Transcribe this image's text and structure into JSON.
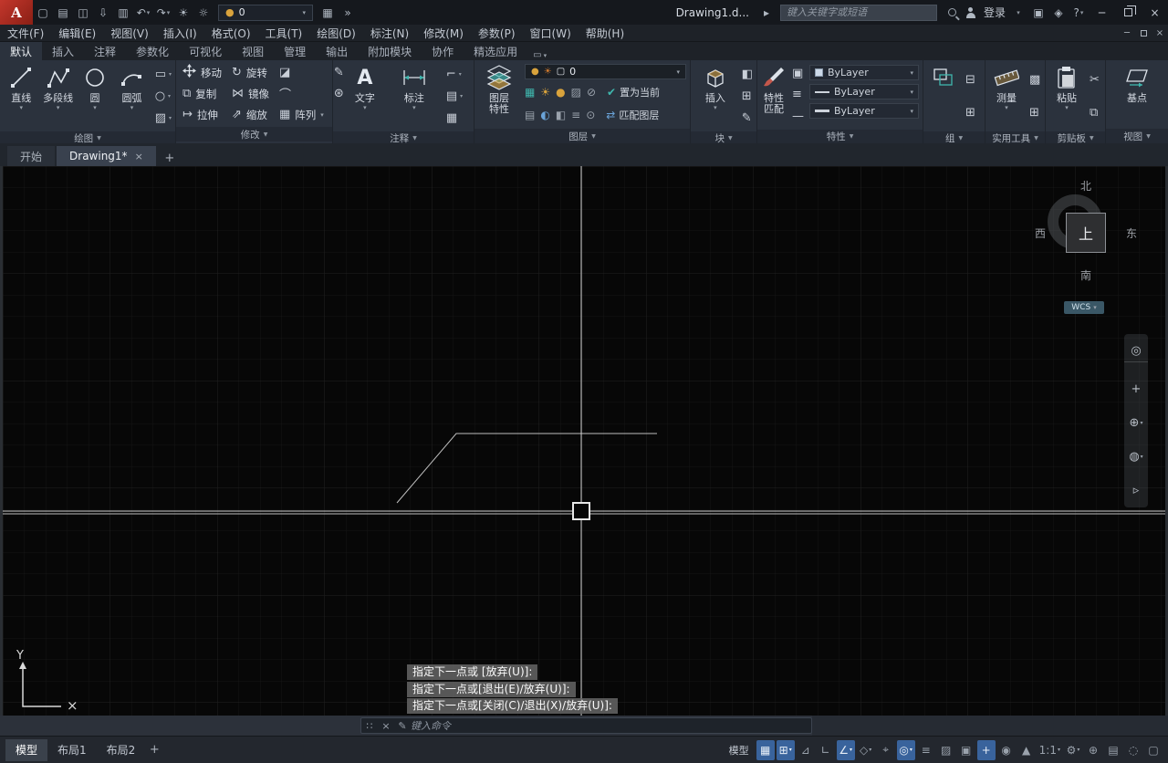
{
  "icons": {
    "logo": "A",
    "caret": "▾",
    "panel_caret": "▼",
    "new": "▢",
    "open": "▤",
    "save": "◫",
    "saveas": "⇩",
    "plot": "▥",
    "undo": "↶",
    "redo": "↷",
    "sun": "☀",
    "light": "☼",
    "bulb": "●",
    "sheet": "▦",
    "overflow": "»",
    "arrow_right": "▸",
    "cart": "▣",
    "bell": "◈",
    "help": "?",
    "min": "─",
    "close": "×",
    "grip": "∷",
    "pencil": "✎",
    "plus": "+",
    "rect_tool": "▭",
    "ellipse_tool": "○",
    "hatch_tool": "▨",
    "rotate": "↻",
    "erase": "◪",
    "copy": "⧉",
    "mirror": "⋈",
    "fillet": "⌒",
    "explode": "⊛",
    "stretch": "↦",
    "scale": "⇗",
    "array": "▦",
    "text_icon": "A",
    "dimstyle": "⌐",
    "table_tool": "▤",
    "leader_tool": "▦",
    "sun_small": "☀",
    "square_small": "▢",
    "check": "✔",
    "match_arrows": "⇄",
    "layer_tool_1": "▦",
    "layer_tool_2": "☀",
    "layer_tool_3": "●",
    "layer_tool_4": "▨",
    "layer_tool_5": "⊘",
    "layer_tool_6": "▤",
    "layer_tool_7": "◐",
    "layer_tool_8": "◧",
    "layer_tool_9": "≡",
    "layer_tool_10": "⊙",
    "attr_1": "◧",
    "attr_2": "⊞",
    "attr_3": "✎",
    "prop_side_1": "▣",
    "prop_side_2": "≡",
    "prop_side_3": "—",
    "group_small_1": "⊟",
    "group_small_2": "⊞",
    "calc": "▩",
    "util_small": "⊞",
    "cut": "✂",
    "paste_small": "⧉",
    "nav_wheel": "◎",
    "nav_pan": "+",
    "nav_zoom": "⊕",
    "nav_orbit": "◍",
    "nav_motion": "▹",
    "ucs_x": "×",
    "status_grid": "▦",
    "status_snap": "⊞",
    "status_infer": "⊿",
    "status_ortho": "∟",
    "status_polar": "∠",
    "status_iso": "◇",
    "status_otrack": "⌖",
    "status_osnap": "◎",
    "status_lwt": "≡",
    "status_transparency": "▨",
    "status_selcycle": "▣",
    "status_dyninput": "+",
    "status_annovis": "◉",
    "status_autoscale": "▲",
    "status_workspace": "⚙",
    "status_annmonitor": "⊕",
    "status_quickprop": "▤",
    "status_isolate": "◌",
    "status_clean": "▢"
  },
  "titlebar": {
    "layer_combo_value": "0",
    "doc_title": "Drawing1.d...",
    "search_placeholder": "键入关键字或短语",
    "login_label": "登录"
  },
  "menubar": {
    "items": [
      "文件(F)",
      "编辑(E)",
      "视图(V)",
      "插入(I)",
      "格式(O)",
      "工具(T)",
      "绘图(D)",
      "标注(N)",
      "修改(M)",
      "参数(P)",
      "窗口(W)",
      "帮助(H)"
    ]
  },
  "ribbon": {
    "tabs": [
      "默认",
      "插入",
      "注释",
      "参数化",
      "可视化",
      "视图",
      "管理",
      "输出",
      "附加模块",
      "协作",
      "精选应用"
    ],
    "panels": {
      "draw": {
        "label": "绘图",
        "line": "直线",
        "polyline": "多段线",
        "circle": "圆",
        "arc": "圆弧"
      },
      "modify": {
        "label": "修改",
        "move": "移动",
        "rotate": "旋转",
        "copy": "复制",
        "mirror": "镜像",
        "stretch": "拉伸",
        "scale": "缩放",
        "array": "阵列"
      },
      "annotate": {
        "label": "注释",
        "text": "文字",
        "dim": "标注"
      },
      "layers": {
        "label": "图层",
        "big_line1": "图层",
        "big_line2": "特性",
        "combo_value": "0",
        "set_current": "置为当前",
        "match_layer": "匹配图层"
      },
      "block": {
        "label": "块",
        "insert": "插入"
      },
      "properties": {
        "label": "特性",
        "match_line1": "特性",
        "match_line2": "匹配",
        "bylayer": "ByLayer"
      },
      "groups": {
        "label": "组"
      },
      "utilities": {
        "label": "实用工具",
        "measure": "测量"
      },
      "clipboard": {
        "label": "剪贴板",
        "paste": "粘贴"
      },
      "view": {
        "label": "视图",
        "base": "基点"
      }
    }
  },
  "filetabs": {
    "start": "开始",
    "drawing1": "Drawing1*"
  },
  "canvas": {
    "prompts": [
      "指定下一点或 [放弃(U)]:",
      "指定下一点或[退出(E)/放弃(U)]:",
      "指定下一点或[关闭(C)/退出(X)/放弃(U)]:"
    ],
    "viewcube": {
      "north": "北",
      "south": "南",
      "east": "东",
      "west": "西",
      "top": "上"
    },
    "wcs_label": "WCS",
    "ucs_y_label": "Y"
  },
  "commandline": {
    "placeholder": "键入命令"
  },
  "statusbar": {
    "model_tab": "模型",
    "layout1_tab": "布局1",
    "layout2_tab": "布局2",
    "model_space": "模型",
    "annotation_scale": "1:1"
  }
}
